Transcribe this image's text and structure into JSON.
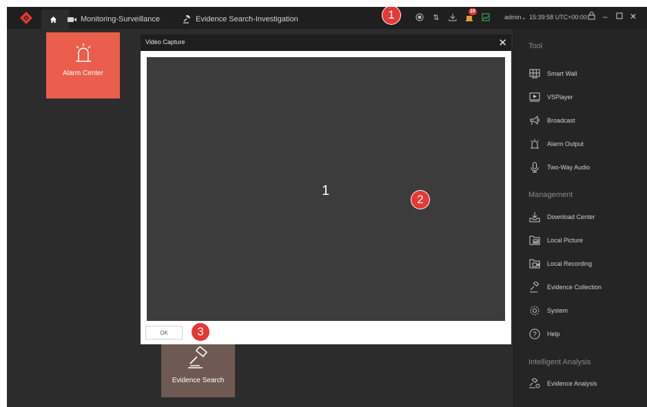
{
  "topbar": {
    "tabs": [
      {
        "label": ""
      },
      {
        "label": "Monitoring-Surveillance"
      },
      {
        "label": "Evidence Search-Investigation"
      }
    ],
    "alarm_count": "10",
    "user": "admin",
    "time": "15:39:58 UTC+00:00"
  },
  "tiles": {
    "alarm_center": "Alarm Center",
    "evidence_search": "Evidence Search"
  },
  "sidebar": {
    "tool_heading": "Tool",
    "tool_items": [
      {
        "label": "Smart Wall",
        "icon": "smart-wall-icon"
      },
      {
        "label": "VSPlayer",
        "icon": "player-icon"
      },
      {
        "label": "Broadcast",
        "icon": "broadcast-icon"
      },
      {
        "label": "Alarm Output",
        "icon": "alarm-output-icon"
      },
      {
        "label": "Two-Way Audio",
        "icon": "microphone-icon"
      }
    ],
    "management_heading": "Management",
    "management_items": [
      {
        "label": "Download Center",
        "icon": "download-icon"
      },
      {
        "label": "Local Picture",
        "icon": "picture-folder-icon"
      },
      {
        "label": "Local Recording",
        "icon": "recording-folder-icon"
      },
      {
        "label": "Evidence Collection",
        "icon": "gavel-icon"
      },
      {
        "label": "System",
        "icon": "gear-icon"
      },
      {
        "label": "Help",
        "icon": "help-icon"
      }
    ],
    "analysis_heading": "Intelligent Analysis",
    "analysis_items": [
      {
        "label": "Evidence Analysis",
        "icon": "evidence-analysis-icon"
      }
    ]
  },
  "dialog": {
    "title": "Video Capture",
    "window_number": "1",
    "ok_label": "OK"
  },
  "callouts": [
    "1",
    "2",
    "3"
  ],
  "colors": {
    "accent": "#ea5e4b",
    "callout": "#e53935",
    "evidence_tile": "#6e5a52"
  }
}
